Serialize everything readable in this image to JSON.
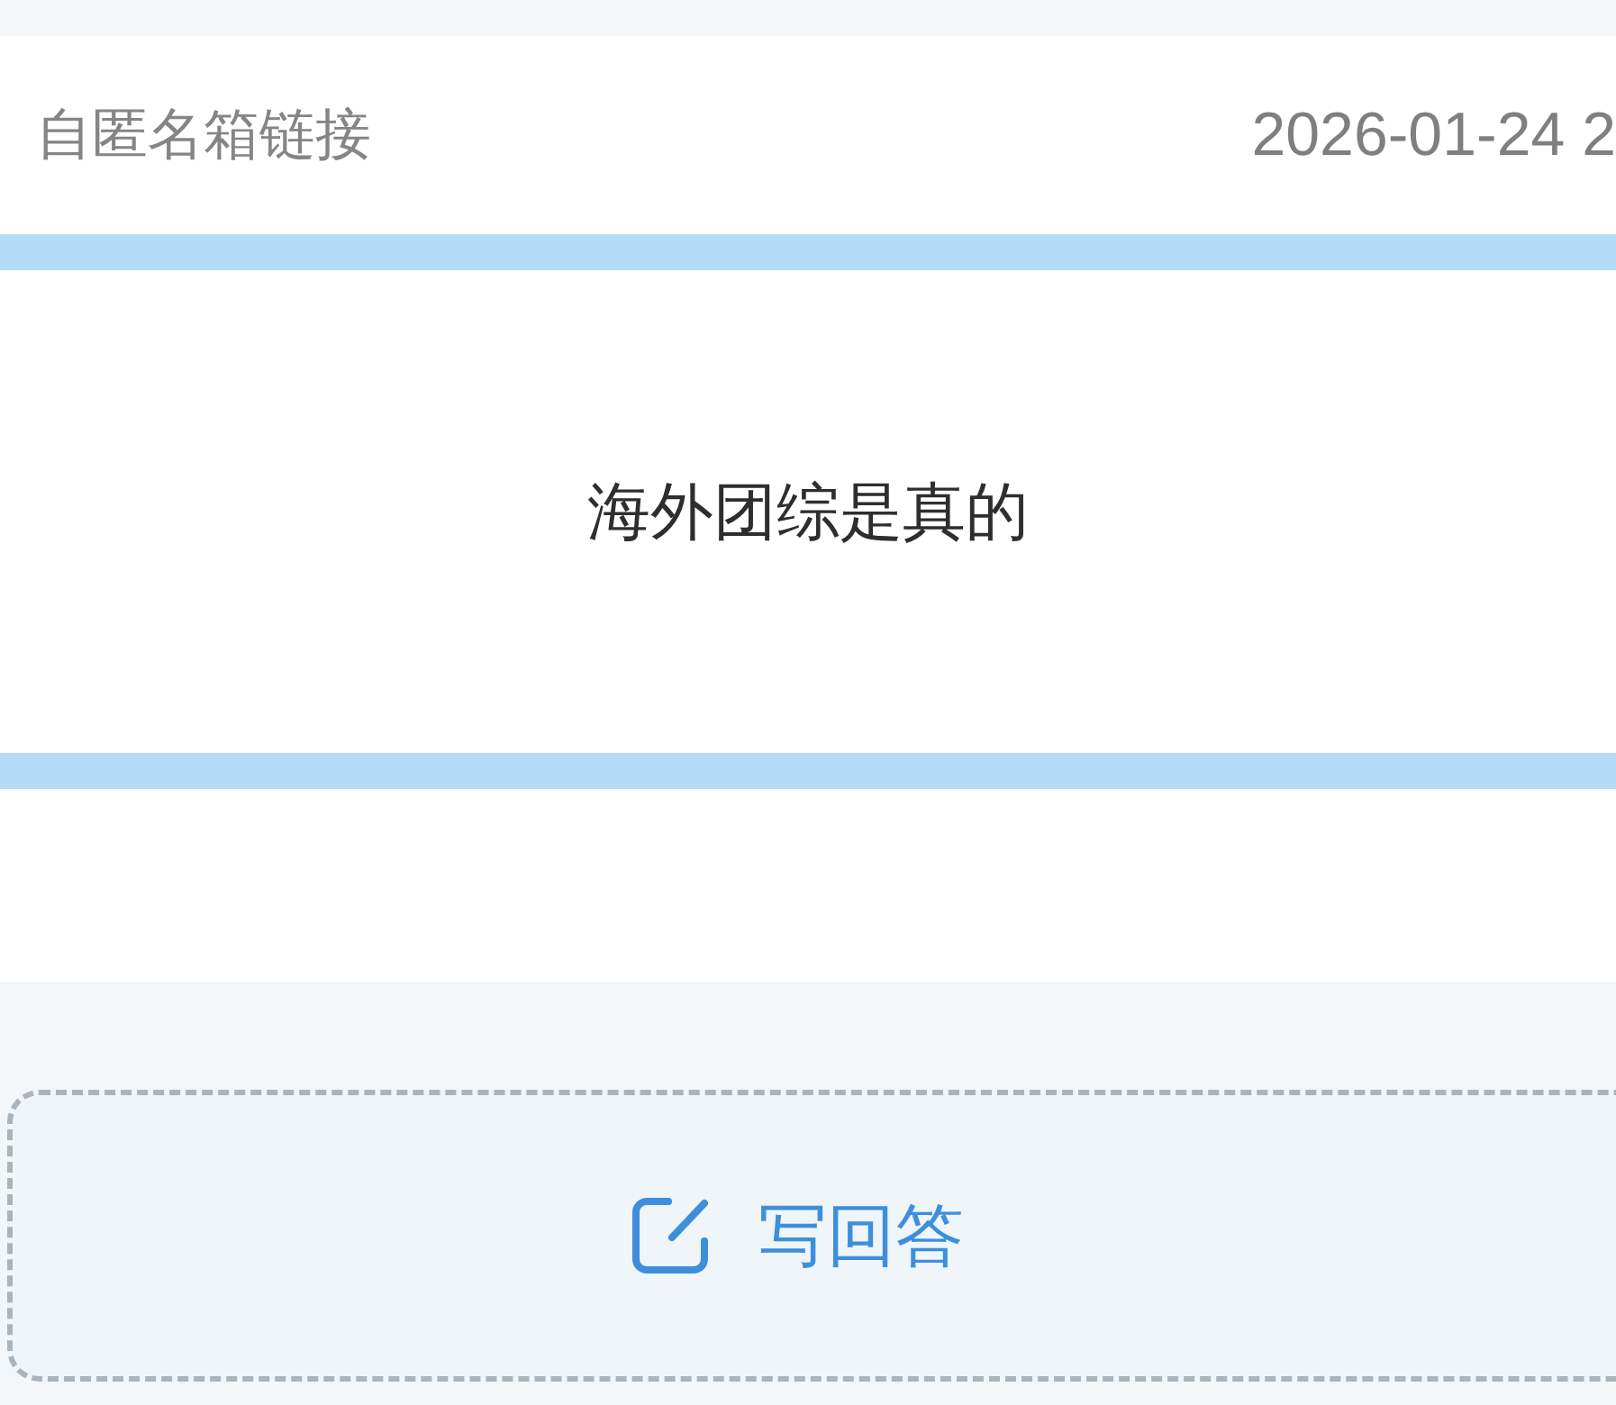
{
  "header": {
    "source": "自匿名箱链接",
    "date": "2026-01-24 2"
  },
  "message": {
    "text": "海外团综是真的"
  },
  "answer_button": {
    "label": "写回答"
  }
}
